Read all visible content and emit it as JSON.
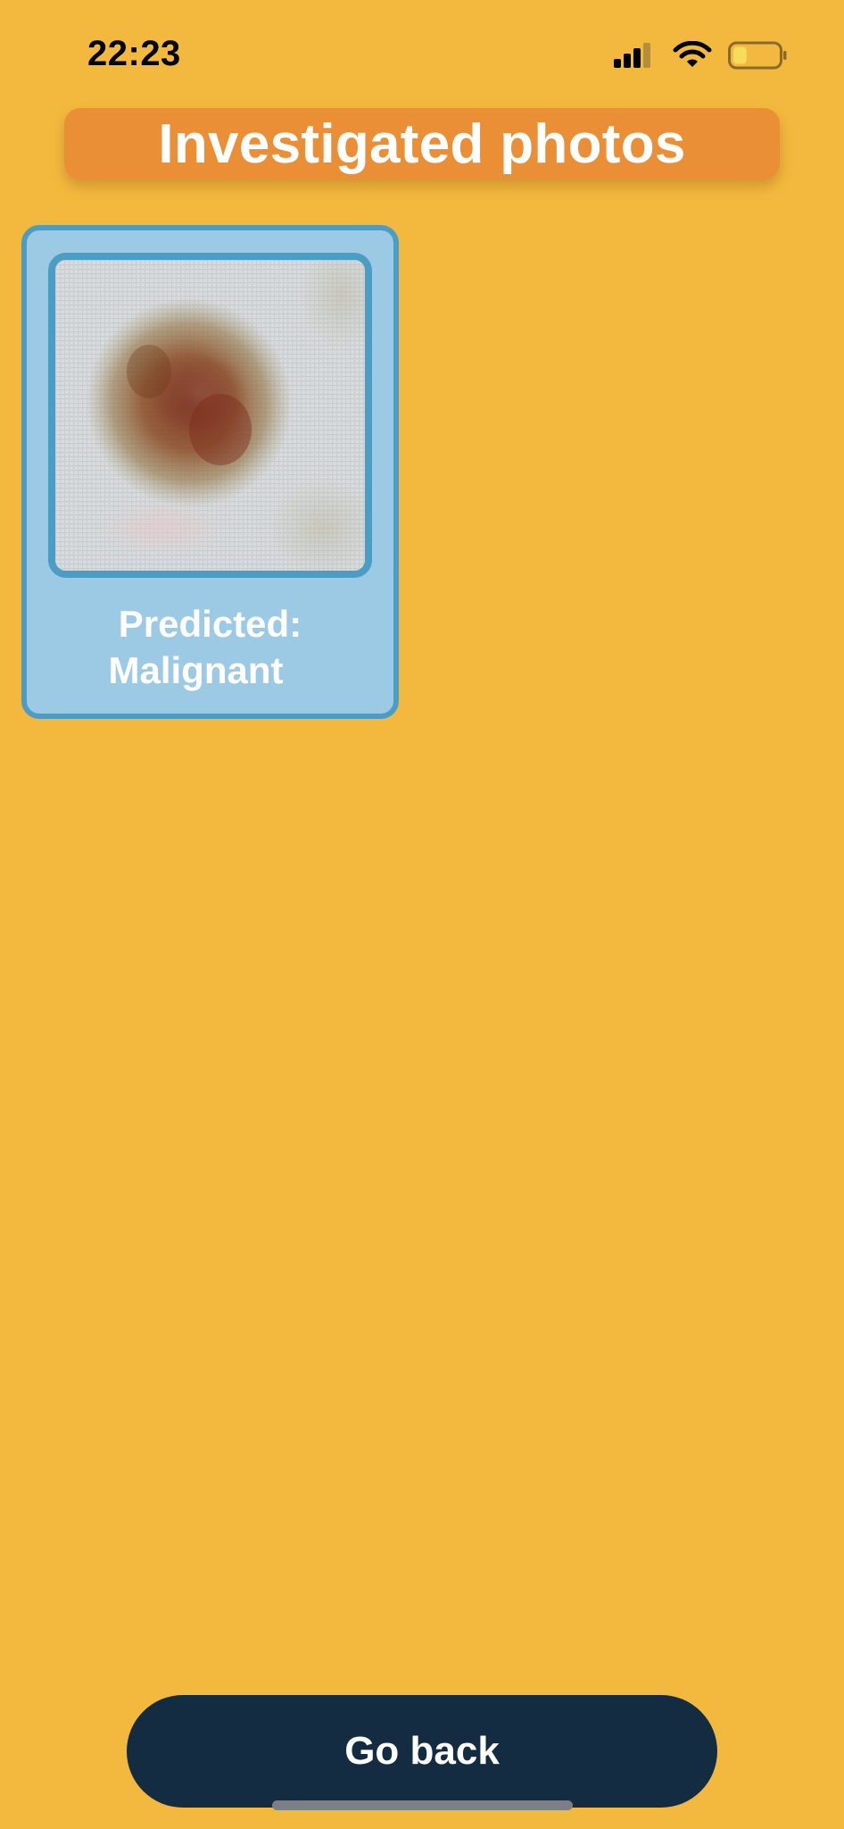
{
  "status_bar": {
    "time": "22:23",
    "icons": [
      "cellular-signal-icon",
      "wifi-icon",
      "battery-icon"
    ],
    "battery_level": 0.3
  },
  "header": {
    "title": "Investigated photos"
  },
  "photos": [
    {
      "image": "skin-lesion-photo",
      "prediction_label": "Predicted:",
      "prediction_value": "Malignant"
    }
  ],
  "footer": {
    "go_back_label": "Go back"
  },
  "colors": {
    "background": "#F3B93E",
    "title_banner": "#EB8F36",
    "card_fill": "#9CCAE4",
    "card_border": "#4C9DC4",
    "button": "#132C42",
    "text_on_color": "#FFFFFF"
  }
}
